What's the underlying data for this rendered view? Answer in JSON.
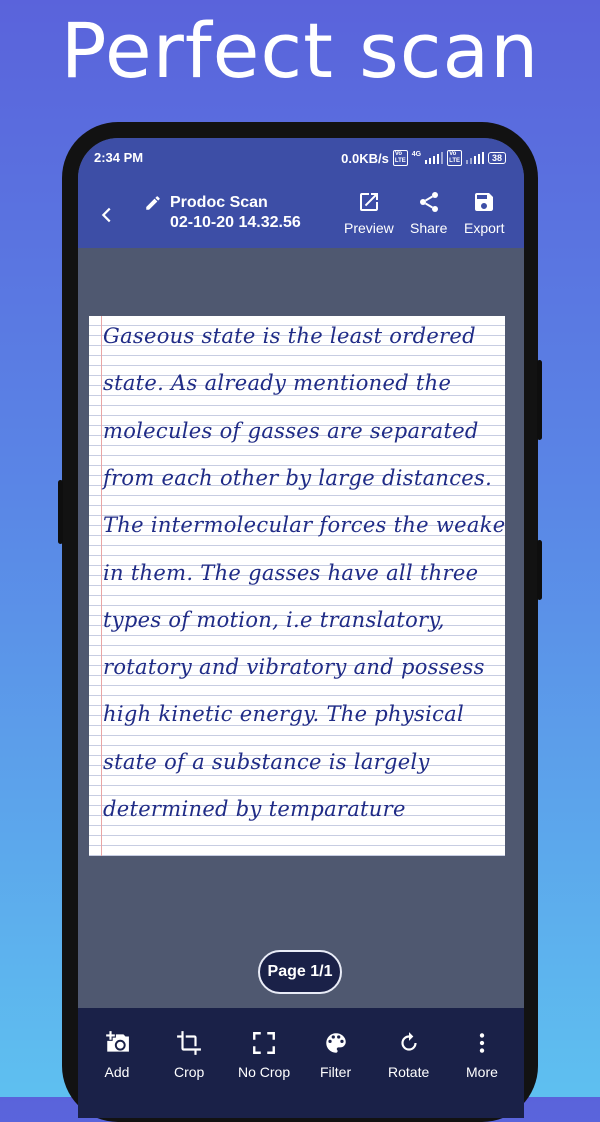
{
  "headline": "Perfect scan",
  "status": {
    "time": "2:34 PM",
    "net_speed": "0.0KB/s",
    "network": "4G",
    "battery": "38"
  },
  "header": {
    "title": "Prodoc Scan",
    "subtitle": "02-10-20 14.32.56",
    "actions": [
      {
        "label": "Preview",
        "icon": "open-in-new-icon"
      },
      {
        "label": "Share",
        "icon": "share-icon"
      },
      {
        "label": "Export",
        "icon": "save-icon"
      }
    ]
  },
  "document": {
    "lines": [
      "Gaseous state is the least ordered",
      "state. As already mentioned the",
      "molecules of gasses are separated",
      "from each other by large distances.",
      "The intermolecular forces the weakest",
      "in them. The gasses have all three",
      "types of motion, i.e translatory,",
      "rotatory and vibratory and possess",
      "high kinetic energy. The physical",
      "state of a substance is largely",
      "determined by temparature"
    ]
  },
  "page_indicator": "Page 1/1",
  "toolbar": {
    "items": [
      {
        "label": "Add",
        "icon": "add-photo-icon"
      },
      {
        "label": "Crop",
        "icon": "crop-icon"
      },
      {
        "label": "No Crop",
        "icon": "fullscreen-icon"
      },
      {
        "label": "Filter",
        "icon": "palette-icon"
      },
      {
        "label": "Rotate",
        "icon": "rotate-icon"
      },
      {
        "label": "More",
        "icon": "more-vert-icon"
      }
    ]
  },
  "colors": {
    "appbar": "#3d4ea6",
    "bottombar": "#1a2148",
    "ink": "#1f2b86"
  }
}
